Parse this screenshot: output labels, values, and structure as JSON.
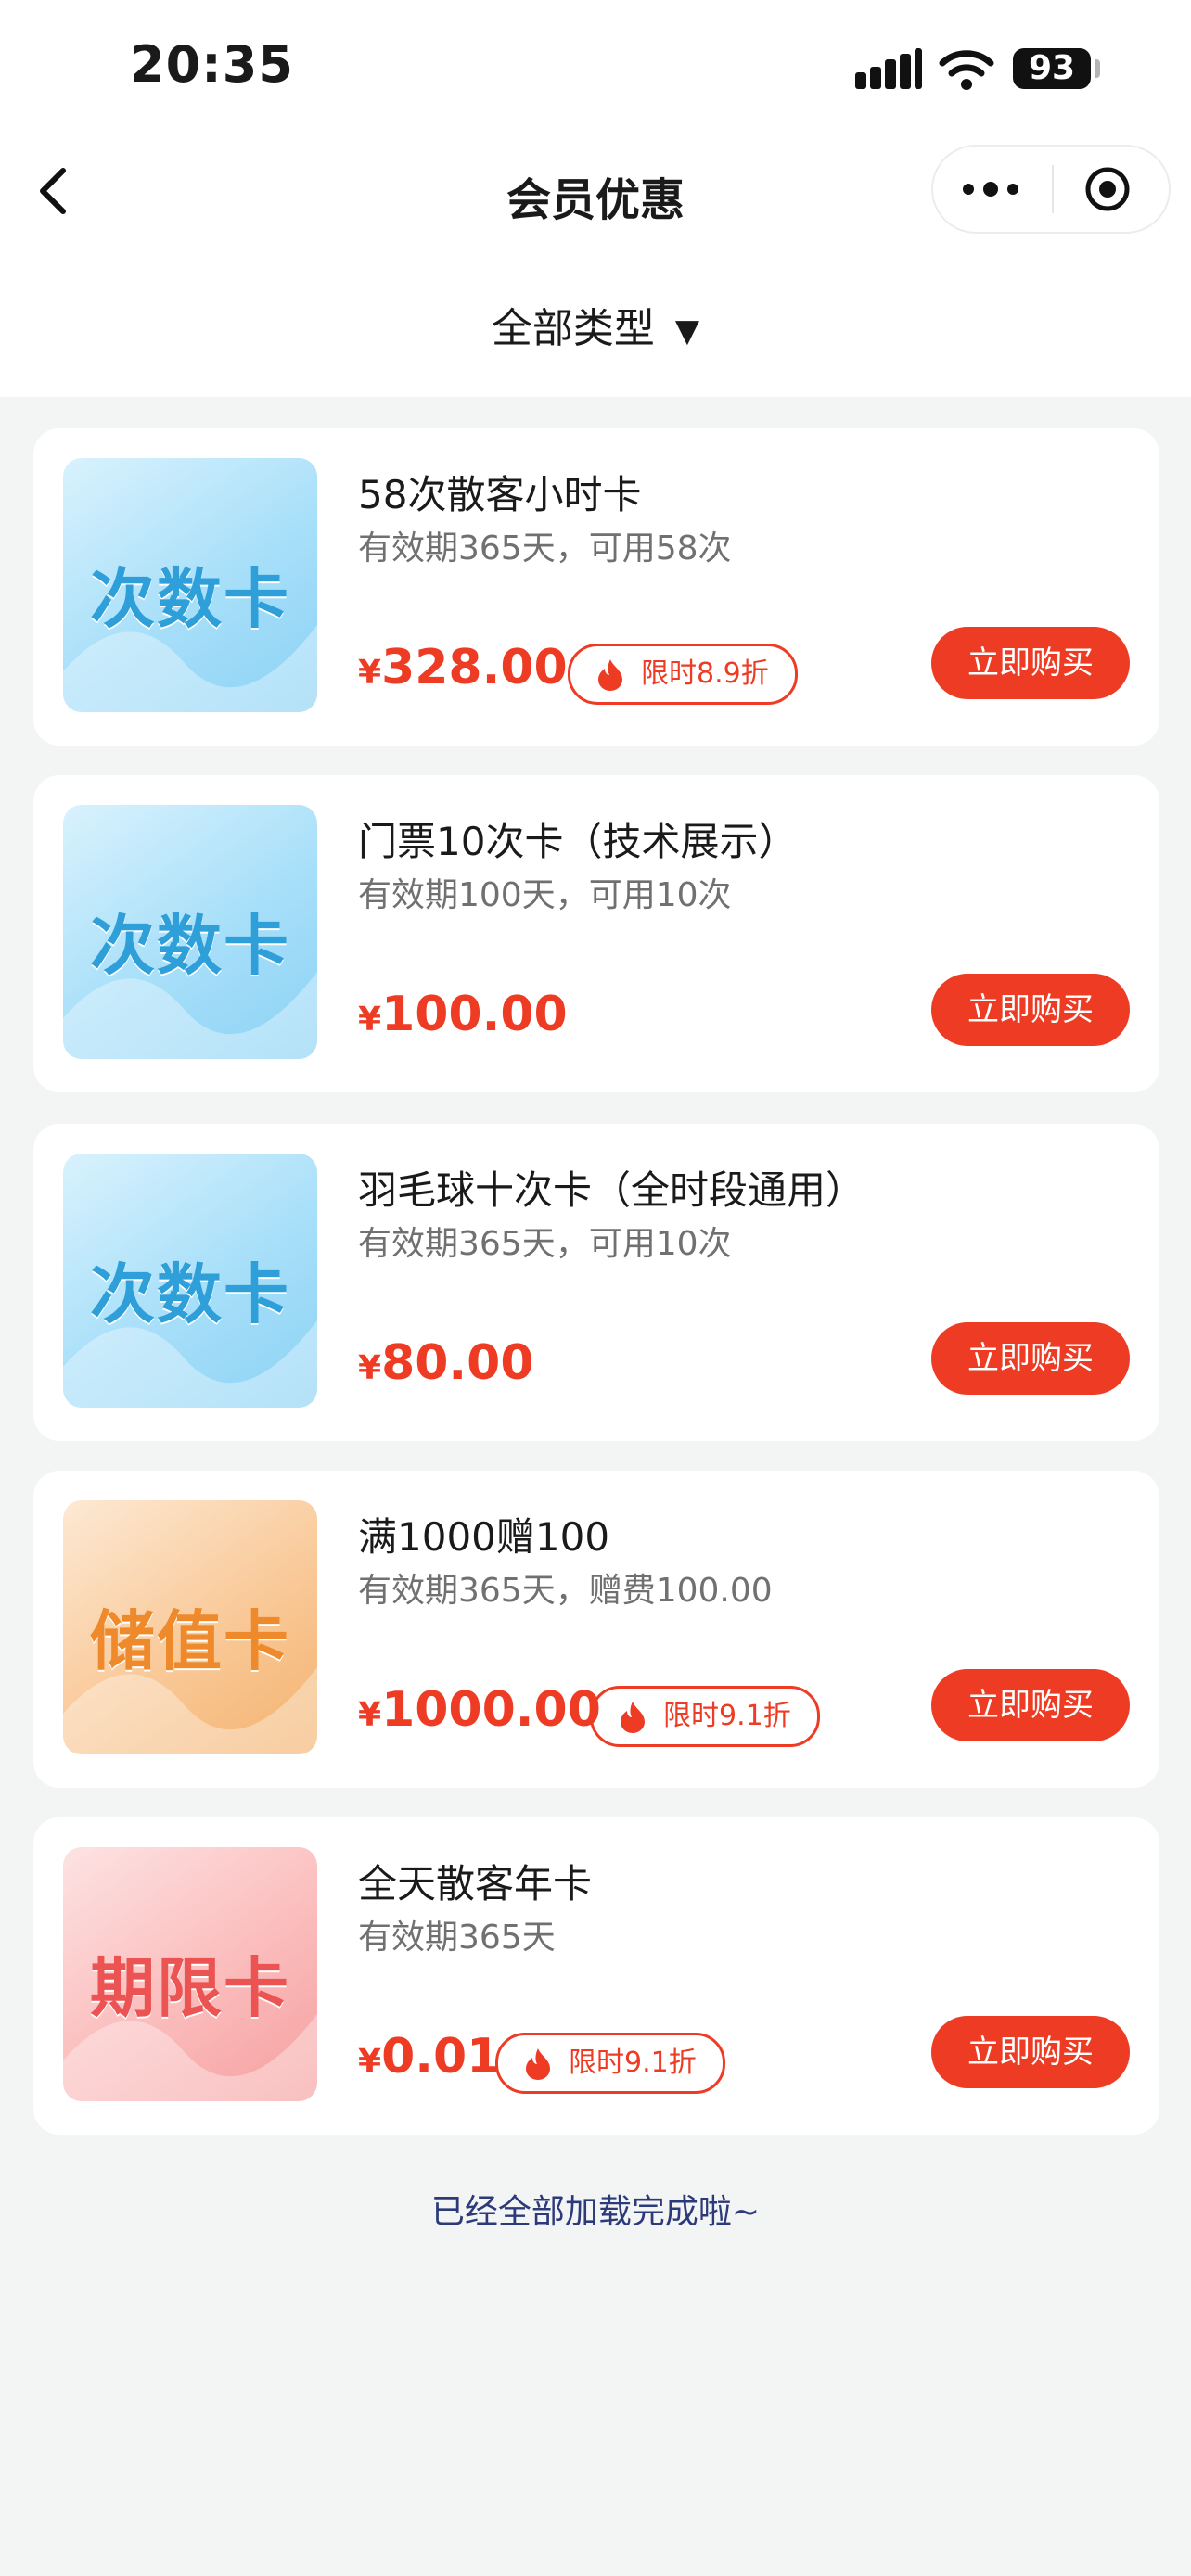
{
  "status_bar": {
    "time": "20:35",
    "battery": "93"
  },
  "nav": {
    "title": "会员优惠"
  },
  "filter": {
    "label": "全部类型"
  },
  "cards": [
    {
      "thumb_label": "次数卡",
      "thumb_color": "#8cd2f5",
      "title": "58次散客小时卡",
      "desc": "有效期365天，可用58次",
      "currency": "¥",
      "price": "328.00",
      "promo": "限时8.9折",
      "buy": "立即购买"
    },
    {
      "thumb_label": "次数卡",
      "thumb_color": "#8cd2f5",
      "title": "门票10次卡（技术展示）",
      "desc": "有效期100天，可用10次",
      "currency": "¥",
      "price": "100.00",
      "promo": "",
      "buy": "立即购买"
    },
    {
      "thumb_label": "次数卡",
      "thumb_color": "#8cd2f5",
      "title": "羽毛球十次卡（全时段通用）",
      "desc": "有效期365天，可用10次",
      "currency": "¥",
      "price": "80.00",
      "promo": "",
      "buy": "立即购买"
    },
    {
      "thumb_label": "储值卡",
      "thumb_color": "#f3b26e",
      "title": "满1000赠100",
      "desc": "有效期365天，赠费100.00",
      "currency": "¥",
      "price": "1000.00",
      "promo": "限时9.1折",
      "buy": "立即购买"
    },
    {
      "thumb_label": "期限卡",
      "thumb_color": "#f59f9f",
      "title": "全天散客年卡",
      "desc": "有效期365天",
      "currency": "¥",
      "price": "0.01",
      "promo": "限时9.1折",
      "buy": "立即购买"
    }
  ],
  "footer": {
    "text": "已经全部加载完成啦~"
  },
  "colors": {
    "accent": "#ee3b24",
    "background": "#f3f4f4",
    "footer_text": "#2d3a7a"
  }
}
